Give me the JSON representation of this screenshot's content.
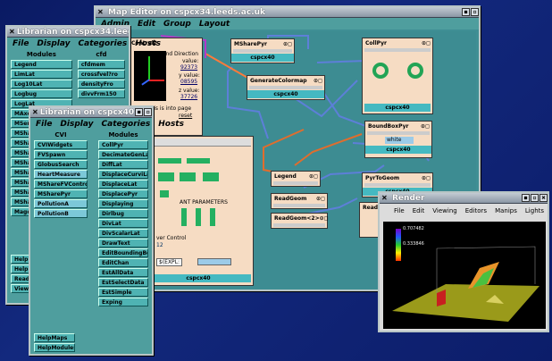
{
  "map_editor": {
    "title": "Map Editor on cspcx34.leeds.ac.uk",
    "menu": [
      "Admin",
      "Edit",
      "Group",
      "Layout"
    ]
  },
  "librarian1": {
    "title": "Librarian on cspcx34.leeds",
    "menu": [
      "File",
      "Display",
      "Categories",
      "Hosts"
    ],
    "col_modules": "Modules",
    "col_cfd": "cfd",
    "left_items": [
      "Legend",
      "LimLat",
      "Log10Lat",
      "Logbug",
      "LogLat",
      "MAxe",
      "MSer",
      "MShar",
      "MShar",
      "MShar",
      "MShar",
      "MShar",
      "MShar",
      "MShar",
      "MShar",
      "Mage"
    ],
    "right_items": [
      "cfdmem",
      "crossfvel?ro",
      "densityFro",
      "divvFrm150"
    ],
    "bottom_items": [
      "HelpM",
      "HelpM",
      "Reade",
      "ViewO"
    ]
  },
  "librarian2": {
    "title": "Librarian on cspcx40",
    "menu": [
      "File",
      "Display",
      "Categories",
      "Hosts"
    ],
    "col_cvi": "CVI",
    "col_modules": "Modules",
    "cvi_items": [
      "CVIWidgets",
      "FVSpawn",
      "GlobusSearch",
      "HeartMeasure",
      "MShareFVControl2",
      "MSharePyr",
      "PollutionA",
      "PollutionB"
    ],
    "mod_items": [
      "CollPyr",
      "DecimateGenLat",
      "DiffLat",
      "DisplaceCurviLat",
      "DisplaceLat",
      "DisplacePyr",
      "Displaying",
      "Dirlbug",
      "DivLat",
      "DivScalarLat",
      "DrawText",
      "EditBoundingBox",
      "EditChan",
      "EstAllData",
      "EstSelectData",
      "EstSimple",
      "Exping"
    ],
    "help_items": [
      "HelpMaps",
      "HelpModules"
    ]
  },
  "modules": {
    "control2": {
      "title": "Control2",
      "wind": "Wind Direction",
      "value_label": "value:",
      "v1": "92373",
      "y_label": "y value:",
      "v2": "08595",
      "z_label": "z value:",
      "v3": "37726",
      "note": "nb: v axis is into page",
      "reset": "reset"
    },
    "msharepyr": {
      "title": "MSharePyr",
      "host": "cspcx40"
    },
    "gencolormap": {
      "title": "GenerateColormap",
      "host": "cspcx40"
    },
    "collpyr": {
      "title": "CollPyr",
      "host": "cspcx40"
    },
    "boundbox": {
      "title": "BoundBoxPyr",
      "value": "white",
      "host": "cspcx40"
    },
    "legend": {
      "title": "Legend"
    },
    "readgeom": {
      "title": "ReadGeom"
    },
    "readgeom2": {
      "title": "ReadGeom<2>"
    },
    "pyrtogeom": {
      "title": "PyrToGeom",
      "host": "cspcx40"
    },
    "reader": {
      "title": "Reader"
    },
    "central": {
      "params": "ANT PARAMETERS",
      "control": "ver Control",
      "expl": "$(EXPL:",
      "num": "12",
      "host": "cspcx40"
    }
  },
  "render": {
    "title": "Render",
    "menu": [
      "File",
      "Edit",
      "Viewing",
      "Editors",
      "Manips",
      "Lights"
    ],
    "legend_top": "0.707482",
    "legend_mid": "0.333846"
  },
  "colors": {
    "desktop": "#0d1f6e",
    "window": "#4f9e9e",
    "module": "#f6dcc3",
    "host_bar": "#45b9c1"
  }
}
